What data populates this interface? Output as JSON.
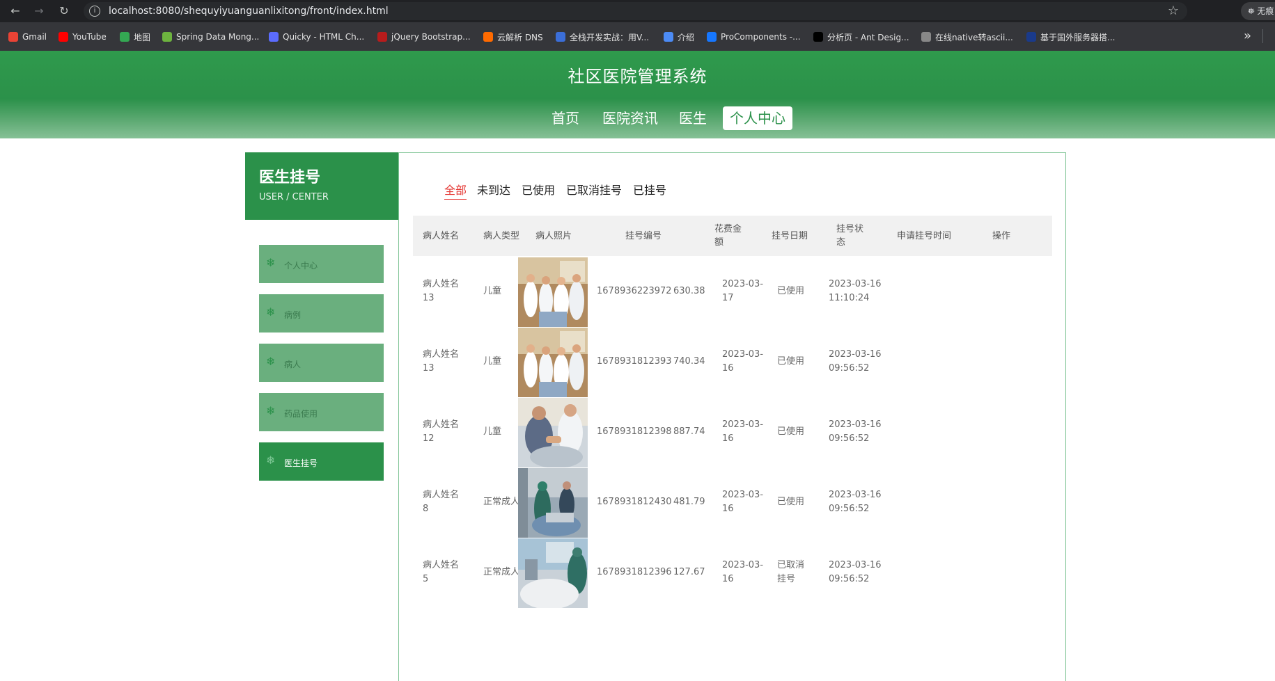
{
  "browser": {
    "url": "localhost:8080/shequyiyuanguanlixitong/front/index.html",
    "profile_label": "无痕",
    "bookmarks": [
      {
        "label": "Gmail",
        "icon": "gmail-icon",
        "color": "#ea4335"
      },
      {
        "label": "YouTube",
        "icon": "youtube-icon",
        "color": "#ff0000"
      },
      {
        "label": "地图",
        "icon": "maps-icon",
        "color": "#34a853"
      },
      {
        "label": "Spring Data Mong...",
        "icon": "spring-icon",
        "color": "#6db33f"
      },
      {
        "label": "Quicky - HTML Ch...",
        "icon": "quicky-icon",
        "color": "#5b6cff"
      },
      {
        "label": "jQuery Bootstrap...",
        "icon": "jquery-icon",
        "color": "#b71c1c"
      },
      {
        "label": "云解析 DNS",
        "icon": "aliyun-icon",
        "color": "#ff6a00"
      },
      {
        "label": "全栈开发实战：用V...",
        "icon": "m-icon",
        "color": "#3b6ed8"
      },
      {
        "label": "介绍",
        "icon": "globe-icon",
        "color": "#4c8bf5"
      },
      {
        "label": "ProComponents -...",
        "icon": "procomponents-icon",
        "color": "#1677ff"
      },
      {
        "label": "分析页 - Ant Desig...",
        "icon": "pro-icon",
        "color": "#000000"
      },
      {
        "label": "在线native转ascii...",
        "icon": "web-icon",
        "color": "#888888"
      },
      {
        "label": "基于国外服务器搭...",
        "icon": "flag-icon",
        "color": "#1a3a8a"
      }
    ]
  },
  "site": {
    "title": "社区医院管理系统",
    "nav": [
      "首页",
      "医院资讯",
      "医生",
      "个人中心"
    ],
    "active_nav": "个人中心"
  },
  "sidebar": {
    "title": "医生挂号",
    "subtitle": "USER / CENTER",
    "items": [
      "个人中心",
      "病例",
      "病人",
      "药品使用",
      "医生挂号"
    ],
    "active_item": "医生挂号"
  },
  "tabs": [
    "全部",
    "未到达",
    "已使用",
    "已取消挂号",
    "已挂号"
  ],
  "active_tab": "全部",
  "table": {
    "headers": [
      "病人姓名",
      "病人类型",
      "病人照片",
      "挂号编号",
      "花费金额",
      "挂号日期",
      "挂号状态",
      "申请挂号时间",
      "操作"
    ],
    "rows": [
      {
        "name": "病人姓名13",
        "type": "儿童",
        "photo": "doctors-ward-photo",
        "reg_no": "1678936223972",
        "cost": "630.38",
        "date": "2023-03-17",
        "status": "已使用",
        "apply_time": "2023-03-16 11:10:24"
      },
      {
        "name": "病人姓名13",
        "type": "儿童",
        "photo": "doctors-ward-photo",
        "reg_no": "1678931812393",
        "cost": "740.34",
        "date": "2023-03-16",
        "status": "已使用",
        "apply_time": "2023-03-16 09:56:52"
      },
      {
        "name": "病人姓名12",
        "type": "儿童",
        "photo": "doctor-patient-photo",
        "reg_no": "1678931812398",
        "cost": "887.74",
        "date": "2023-03-16",
        "status": "已使用",
        "apply_time": "2023-03-16 09:56:52"
      },
      {
        "name": "病人姓名8",
        "type": "正常成人",
        "photo": "surgery-team-photo",
        "reg_no": "1678931812430",
        "cost": "481.79",
        "date": "2023-03-16",
        "status": "已使用",
        "apply_time": "2023-03-16 09:56:52"
      },
      {
        "name": "病人姓名5",
        "type": "正常成人",
        "photo": "operating-room-photo",
        "reg_no": "1678931812396",
        "cost": "127.67",
        "date": "2023-03-16",
        "status": "已取消挂号",
        "apply_time": "2023-03-16 09:56:52"
      }
    ]
  },
  "colors": {
    "brand_green": "#2b914a",
    "menu_green": "#6aaf7e",
    "active_tab_red": "#e53935"
  }
}
